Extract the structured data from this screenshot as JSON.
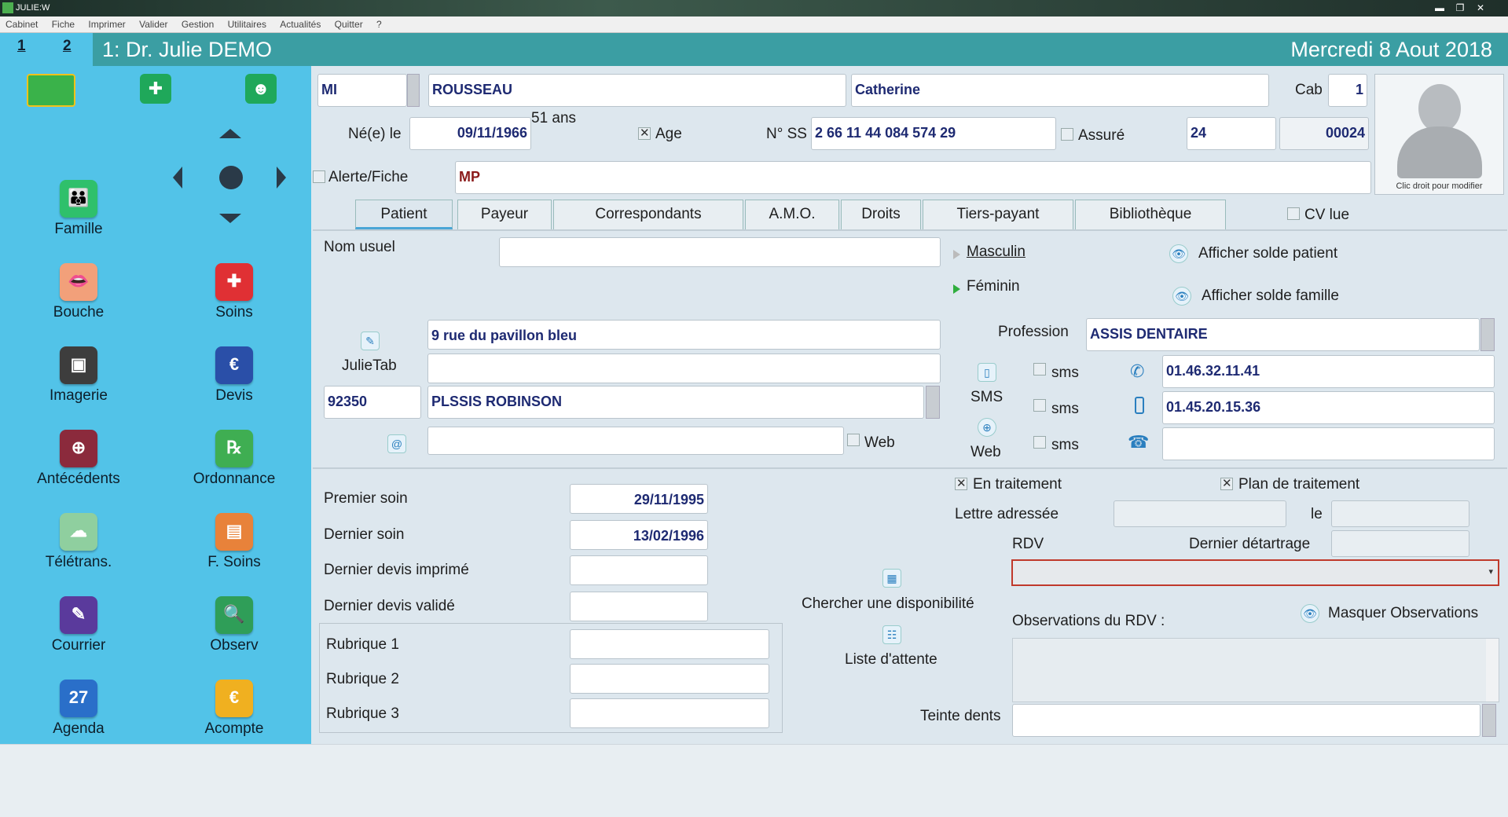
{
  "window": {
    "title": "JULIE:W",
    "minimize": "▬",
    "restore": "❐",
    "close": "✕"
  },
  "menu": [
    "Cabinet",
    "Fiche",
    "Imprimer",
    "Valider",
    "Gestion",
    "Utilitaires",
    "Actualités",
    "Quitter",
    "?"
  ],
  "header": {
    "tab1": "1",
    "tab2": "2",
    "doctor": "1:  Dr. Julie DEMO",
    "date": "Mercredi 8 Aout 2018"
  },
  "sidebar": {
    "items": [
      {
        "label": "Famille",
        "icon": "family-icon",
        "color": "#2fc06b",
        "glyph": "👪"
      },
      {
        "label": "Bouche",
        "icon": "mouth-icon",
        "color": "#f2a07a",
        "glyph": "👄"
      },
      {
        "label": "Soins",
        "icon": "tooth-care-icon",
        "color": "#e03034",
        "glyph": "✚"
      },
      {
        "label": "Imagerie",
        "icon": "xray-icon",
        "color": "#3d3d3d",
        "glyph": "▣"
      },
      {
        "label": "Devis",
        "icon": "quote-icon",
        "color": "#2a4fa8",
        "glyph": "€"
      },
      {
        "label": "Antécédents",
        "icon": "history-icon",
        "color": "#8b2a3c",
        "glyph": "⊕"
      },
      {
        "label": "Ordonnance",
        "icon": "prescription-icon",
        "color": "#3fae52",
        "glyph": "℞"
      },
      {
        "label": "Télétrans.",
        "icon": "teletrans-icon",
        "color": "#8fcf9f",
        "glyph": "☁"
      },
      {
        "label": "F. Soins",
        "icon": "care-sheet-icon",
        "color": "#e8823a",
        "glyph": "▤"
      },
      {
        "label": "Courrier",
        "icon": "mail-icon",
        "color": "#5a3a9c",
        "glyph": "✎"
      },
      {
        "label": "Observ",
        "icon": "observation-icon",
        "color": "#2f9e58",
        "glyph": "🔍"
      },
      {
        "label": "Agenda",
        "icon": "calendar-icon",
        "color": "#2a6fc9",
        "glyph": "27"
      },
      {
        "label": "Acompte",
        "icon": "deposit-icon",
        "color": "#f0b020",
        "glyph": "€"
      }
    ]
  },
  "patient": {
    "title": "MI",
    "lastname": "ROUSSEAU",
    "firstname": "Catherine",
    "cab_label": "Cab",
    "cab": "1",
    "birth_label": "Né(e) le",
    "birthdate": "09/11/1966",
    "age": "51 ans",
    "age_label": "Age",
    "ss_label": "N° SS",
    "ss": "2 66 11 44 084 574 29",
    "insured_label": "Assuré",
    "num1": "24",
    "num2": "00024",
    "alert_label": "Alerte/Fiche",
    "alert": "MP",
    "photo_caption": "Clic droit pour modifier"
  },
  "tabs": [
    "Patient",
    "Payeur",
    "Correspondants",
    "A.M.O.",
    "Droits",
    "Tiers-payant",
    "Bibliothèque"
  ],
  "cv_label": "CV lue",
  "details": {
    "nom_usuel_label": "Nom usuel",
    "nom_usuel": "",
    "masculin": "Masculin",
    "feminin": "Féminin",
    "solde_patient": "Afficher solde patient",
    "solde_famille": "Afficher solde famille",
    "address1": "9 rue du pavillon bleu",
    "address2": "",
    "julietab": "JulieTab",
    "zip": "92350",
    "city": "PLSSIS ROBINSON",
    "email": "",
    "web_label": "Web",
    "profession_label": "Profession",
    "profession": "ASSIS DENTAIRE",
    "sms_label": "SMS",
    "web2_label": "Web",
    "sms": "sms",
    "phone1": "01.46.32.11.41",
    "phone2": "01.45.20.15.36",
    "phone3": ""
  },
  "care": {
    "premier_label": "Premier soin",
    "premier": "29/11/1995",
    "dernier_label": "Dernier soin",
    "dernier": "13/02/1996",
    "devis_imprime_label": "Dernier devis imprimé",
    "devis_valide_label": "Dernier devis validé",
    "rubrique1": "Rubrique 1",
    "rubrique2": "Rubrique 2",
    "rubrique3": "Rubrique 3",
    "chercher": "Chercher une disponibilité",
    "liste": "Liste d'attente",
    "en_traitement": "En traitement",
    "plan": "Plan de traitement",
    "lettre_label": "Lettre adressée",
    "le_label": "le",
    "rdv_label": "RDV",
    "detartrage_label": "Dernier détartrage",
    "observations_label": "Observations du RDV :",
    "masquer": "Masquer Observations",
    "teinte_label": "Teinte dents"
  }
}
